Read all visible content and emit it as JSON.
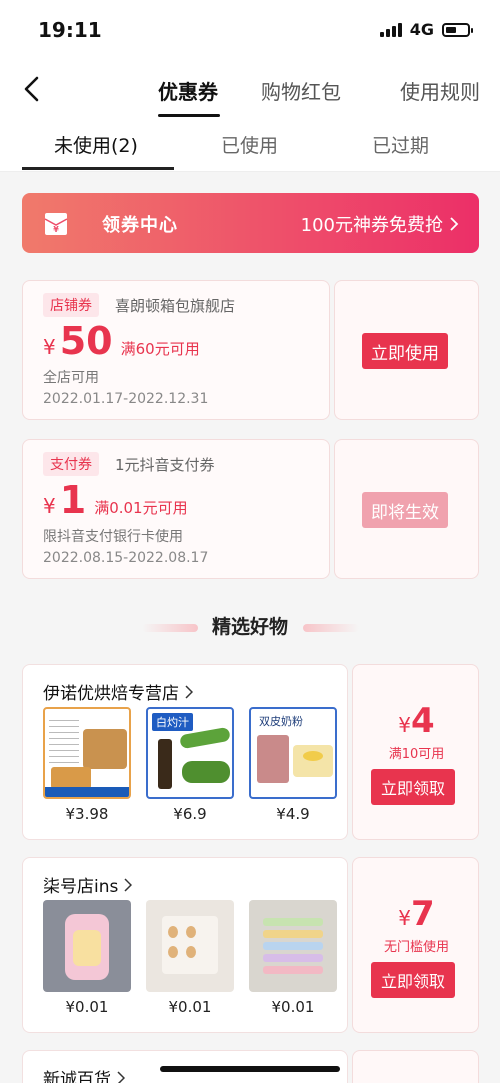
{
  "status": {
    "time": "19:11",
    "network": "4G",
    "battery_level": 0.5
  },
  "nav": {
    "tabs": [
      {
        "label": "优惠券"
      },
      {
        "label": "购物红包"
      },
      {
        "label": "使用规则"
      }
    ]
  },
  "sub_tabs": [
    {
      "label": "未使用(2)"
    },
    {
      "label": "已使用"
    },
    {
      "label": "已过期"
    }
  ],
  "banner": {
    "title": "领券中心",
    "promo": "100元神券免费抢"
  },
  "coupons": [
    {
      "tag": "店铺券",
      "shop": "喜朗顿箱包旗舰店",
      "currency": "¥",
      "amount": "50",
      "condition": "满60元可用",
      "scope": "全店可用",
      "date": "2022.01.17-2022.12.31",
      "button": "立即使用"
    },
    {
      "tag": "支付券",
      "shop": "1元抖音支付券",
      "currency": "¥",
      "amount": "1",
      "condition": "满0.01元可用",
      "scope": "限抖音支付银行卡使用",
      "date": "2022.08.15-2022.08.17",
      "button": "即将生效"
    }
  ],
  "section_title": "精选好物",
  "shops": [
    {
      "name": "伊诺优烘焙专营店",
      "products": [
        {
          "price": "¥3.98",
          "image_text": ""
        },
        {
          "price": "¥6.9",
          "image_text": "白灼汁"
        },
        {
          "price": "¥4.9",
          "image_text": "双皮奶粉"
        }
      ],
      "currency": "¥",
      "amount": "4",
      "condition": "满10可用",
      "button": "立即领取"
    },
    {
      "name": "柒号店ins",
      "products": [
        {
          "price": "¥0.01",
          "image_text": ""
        },
        {
          "price": "¥0.01",
          "image_text": ""
        },
        {
          "price": "¥0.01",
          "image_text": ""
        }
      ],
      "currency": "¥",
      "amount": "7",
      "condition": "无门槛使用",
      "button": "立即领取"
    },
    {
      "name": "新诚百货"
    }
  ],
  "colors": {
    "accent": "#e8344e",
    "banner_start": "#f07a6b",
    "banner_end": "#ec2f68"
  }
}
